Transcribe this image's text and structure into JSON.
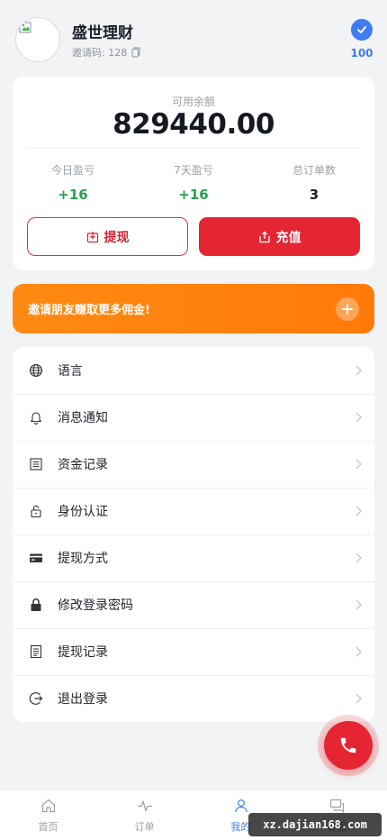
{
  "profile": {
    "name": "盛世理财",
    "invite_text": "邀请码: 128",
    "level": "100"
  },
  "balance": {
    "label": "可用余额",
    "value": "829440.00"
  },
  "stats": [
    {
      "label": "今日盈亏",
      "value": "+16"
    },
    {
      "label": "7天盈亏",
      "value": "+16"
    },
    {
      "label": "总订单数",
      "value": "3"
    }
  ],
  "actions": {
    "withdraw": "提现",
    "recharge": "充值"
  },
  "banner": {
    "text": "邀请朋友赚取更多佣金!"
  },
  "menu": [
    {
      "label": "语言",
      "icon": "globe-icon"
    },
    {
      "label": "消息通知",
      "icon": "bell-icon"
    },
    {
      "label": "资金记录",
      "icon": "list-icon"
    },
    {
      "label": "身份认证",
      "icon": "lock-open-icon"
    },
    {
      "label": "提现方式",
      "icon": "card-icon"
    },
    {
      "label": "修改登录密码",
      "icon": "lock-icon"
    },
    {
      "label": "提现记录",
      "icon": "record-icon"
    },
    {
      "label": "退出登录",
      "icon": "logout-icon"
    }
  ],
  "nav": [
    {
      "label": "首页",
      "icon": "home-icon"
    },
    {
      "label": "订单",
      "icon": "pulse-icon"
    },
    {
      "label": "我的",
      "icon": "user-icon"
    },
    {
      "label": "客服",
      "icon": "chat-icon"
    }
  ],
  "watermark": "xz.dajian168.com",
  "colors": {
    "brand_red": "#e52532",
    "accent_blue": "#3e7cf0",
    "profit_green": "#27a050",
    "banner_orange": "#ff8a13"
  }
}
